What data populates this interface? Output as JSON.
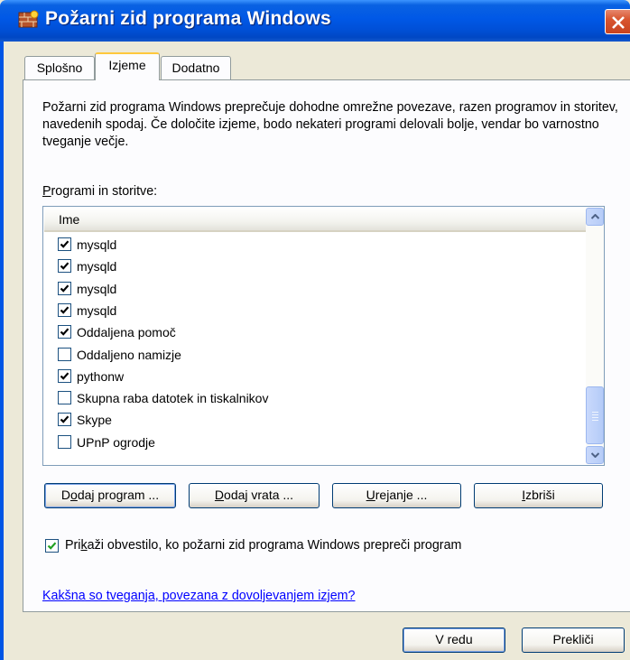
{
  "window": {
    "title": "Požarni zid programa Windows",
    "title_bar_color": "#0055e5",
    "close_color": "#d8552f"
  },
  "tabs": [
    {
      "label": "Splošno",
      "active": false
    },
    {
      "label": "Izjeme",
      "active": true
    },
    {
      "label": "Dodatno",
      "active": false
    }
  ],
  "description": "Požarni zid programa Windows preprečuje dohodne omrežne povezave, razen programov in storitev, navedenih spodaj. Če določite izjeme, bodo nekateri programi delovali bolje, vendar bo varnostno tveganje večje.",
  "programs_label": "Programi in storitve:",
  "list": {
    "column_header": "Ime",
    "items": [
      {
        "label": "mysqld",
        "checked": true
      },
      {
        "label": "mysqld",
        "checked": true
      },
      {
        "label": "mysqld",
        "checked": true
      },
      {
        "label": "mysqld",
        "checked": true
      },
      {
        "label": "Oddaljena pomoč",
        "checked": true
      },
      {
        "label": "Oddaljeno namizje",
        "checked": false
      },
      {
        "label": "pythonw",
        "checked": true
      },
      {
        "label": "Skupna raba datotek in tiskalnikov",
        "checked": false
      },
      {
        "label": "Skype",
        "checked": true
      },
      {
        "label": "UPnP ogrodje",
        "checked": false
      }
    ],
    "scroll_position_fraction": 0.85
  },
  "buttons": {
    "add_program_prefix": "D",
    "add_program_mnemonic": "o",
    "add_program_rest": "daj program ...",
    "add_port_mnemonic": "D",
    "add_port_rest": "odaj vrata ...",
    "edit_mnemonic": "U",
    "edit_rest": "rejanje ...",
    "delete_mnemonic": "I",
    "delete_rest": "zbriši"
  },
  "notify": {
    "checked": true,
    "prefix": "Pri",
    "mnemonic": "k",
    "rest": "aži obvestilo, ko požarni zid programa Windows prepreči program"
  },
  "link_text": "Kakšna so tveganja, povezana z dovoljevanjem izjem?",
  "footer": {
    "ok_label": "V redu",
    "cancel_label": "Prekliči"
  }
}
